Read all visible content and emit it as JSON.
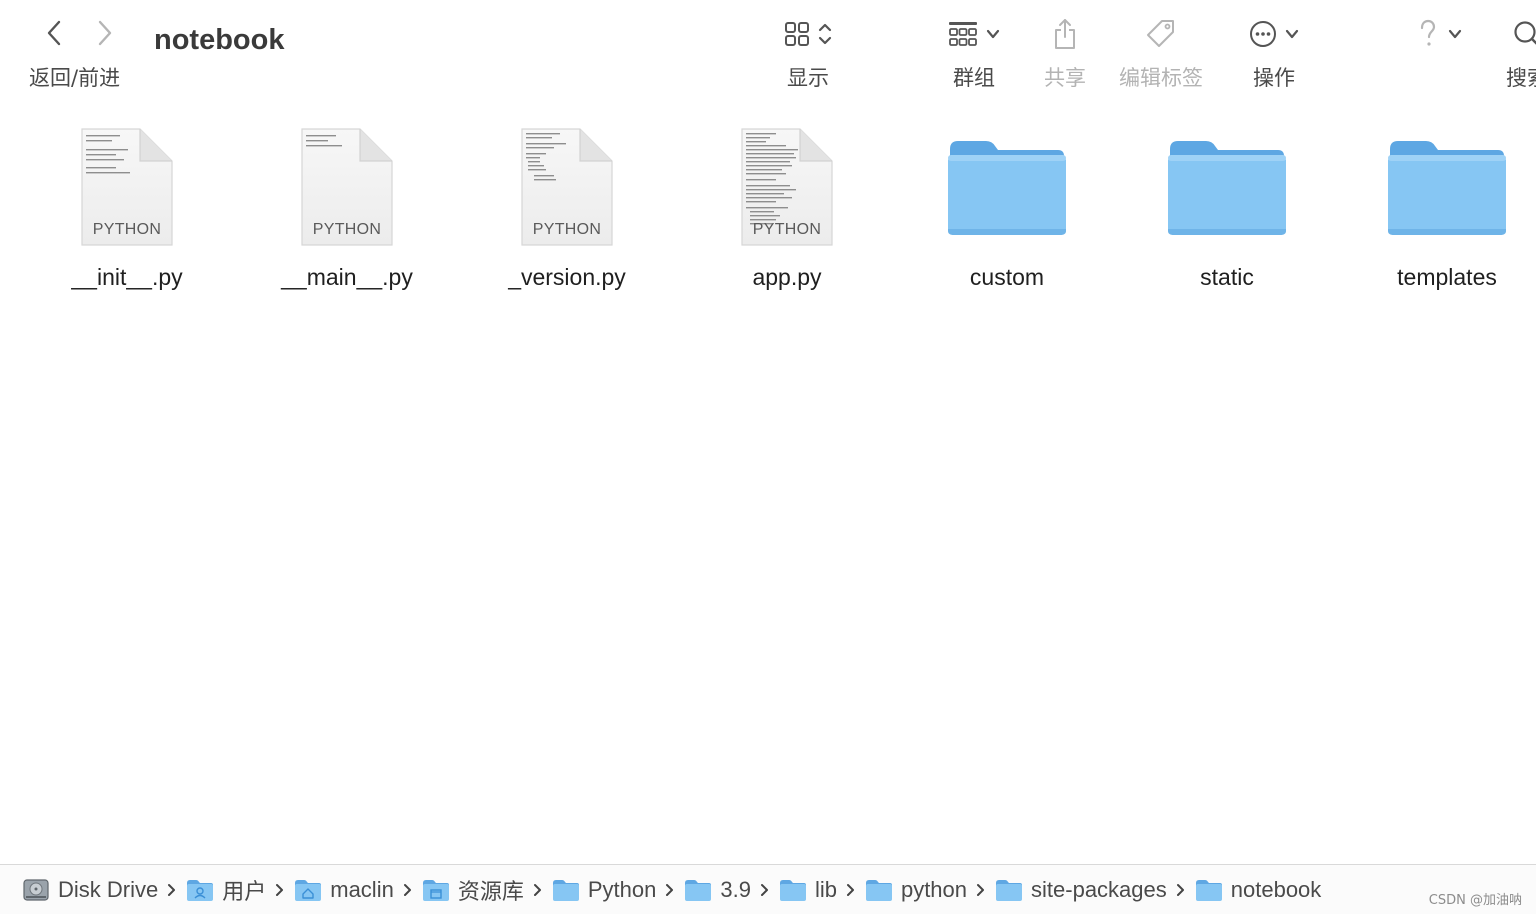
{
  "window": {
    "title": "notebook"
  },
  "toolbar": {
    "nav_label": "返回/前进",
    "view_label": "显示",
    "group_label": "群组",
    "share_label": "共享",
    "tags_label": "编辑标签",
    "action_label": "操作",
    "search_label": "搜索"
  },
  "items": [
    {
      "name": "__init__.py",
      "kind": "PYTHON",
      "type": "file",
      "icon": "python-file-icon"
    },
    {
      "name": "__main__.py",
      "kind": "PYTHON",
      "type": "file",
      "icon": "python-file-icon"
    },
    {
      "name": "_version.py",
      "kind": "PYTHON",
      "type": "file",
      "icon": "python-file-icon"
    },
    {
      "name": "app.py",
      "kind": "PYTHON",
      "type": "file",
      "icon": "python-file-icon"
    },
    {
      "name": "custom",
      "type": "folder",
      "icon": "folder-icon"
    },
    {
      "name": "static",
      "type": "folder",
      "icon": "folder-icon"
    },
    {
      "name": "templates",
      "type": "folder",
      "icon": "folder-icon"
    }
  ],
  "path": [
    {
      "label": "Disk Drive",
      "icon": "disk-drive-icon"
    },
    {
      "label": "用户",
      "icon": "users-folder-icon"
    },
    {
      "label": "maclin",
      "icon": "home-folder-icon"
    },
    {
      "label": "资源库",
      "icon": "library-folder-icon"
    },
    {
      "label": "Python",
      "icon": "folder-icon"
    },
    {
      "label": "3.9",
      "icon": "folder-icon"
    },
    {
      "label": "lib",
      "icon": "folder-icon"
    },
    {
      "label": "python",
      "icon": "folder-icon"
    },
    {
      "label": "site-packages",
      "icon": "folder-icon"
    },
    {
      "label": "notebook",
      "icon": "folder-icon"
    }
  ],
  "watermark": "CSDN @加油呐",
  "colors": {
    "folder_blue": "#86c6f3",
    "folder_tab": "#5ea7e3",
    "label_gray": "#4a4a4a",
    "disabled_gray": "#b3b3b3"
  }
}
